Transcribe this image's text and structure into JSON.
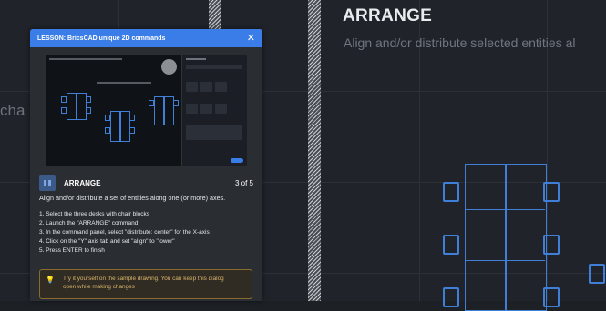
{
  "background": {
    "left_faint_text": "cha"
  },
  "heading": {
    "title": "ARRANGE",
    "subtitle": "Align and/or distribute selected entities al"
  },
  "dialog": {
    "title": "LESSON: BricsCAD unique 2D commands",
    "close_icon": "close-icon",
    "step": {
      "icon": "arrange-icon",
      "name": "ARRANGE",
      "counter": "3 of 5"
    },
    "description": "Align and/or distribute a set of entities along one (or more) axes.",
    "steps": [
      "1. Select the three desks with chair blocks",
      "2. Launch the \"ARRANGE\" command",
      "3. In the command panel, select \"distribute: center\" for the X-axis",
      "4. Click on the \"Y\" axis tab and set \"align\" to \"lower\"",
      "5. Press ENTER to finish"
    ],
    "tip": {
      "icon": "lightbulb-icon",
      "text_line1": "Try it yourself on the sample drawing. You can keep this dialog",
      "text_line2": "open while making changes"
    }
  },
  "colors": {
    "accent": "#3a7de8",
    "table_stroke": "#3f7fd8",
    "tip_border": "#8a6d2c"
  }
}
